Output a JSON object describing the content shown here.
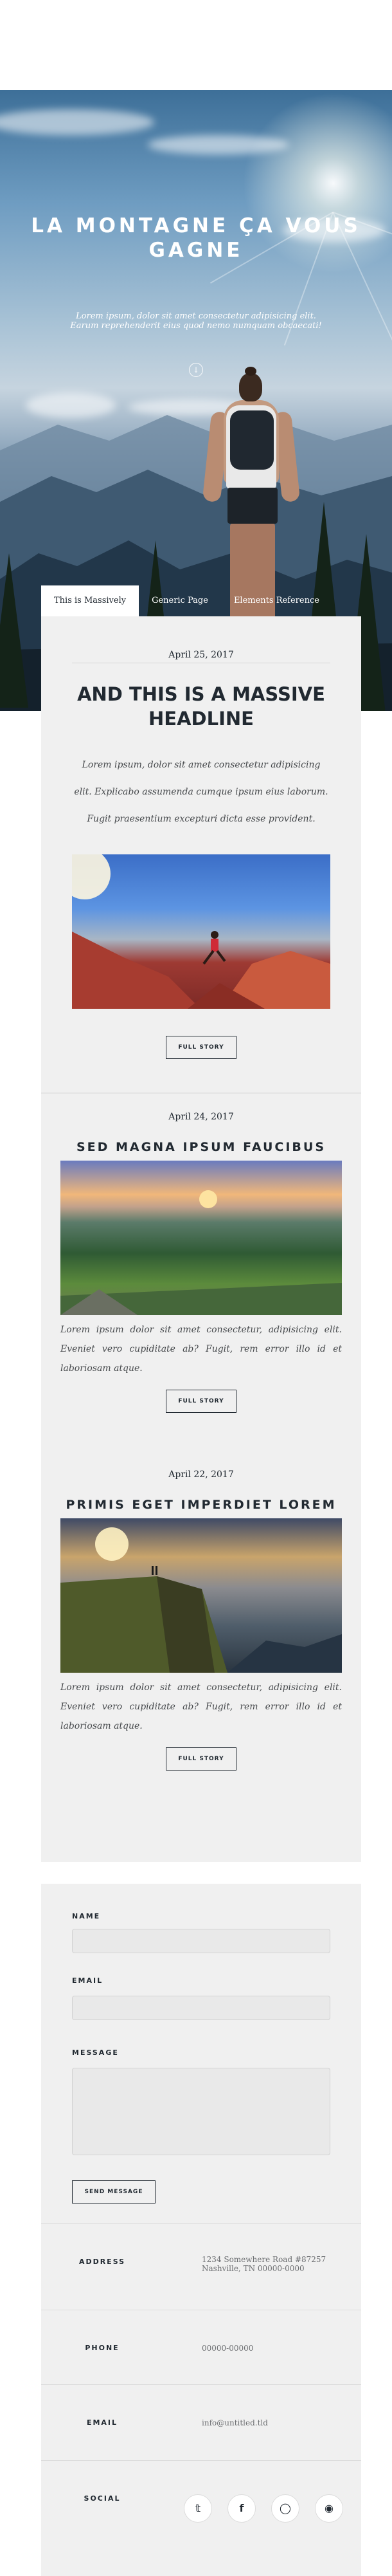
{
  "hero": {
    "title": "LA MONTAGNE ÇA VOUS GAGNE",
    "subtitle": "Lorem ipsum, dolor sit amet consectetur adipisicing elit. Earum reprehenderit eius quod nemo numquam obcaecati!",
    "scroll_icon": "arrow-down-icon"
  },
  "tabs": [
    {
      "label": "This is Massively",
      "active": true
    },
    {
      "label": "Generic Page",
      "active": false
    },
    {
      "label": "Elements Reference",
      "active": false
    }
  ],
  "featured": {
    "date": "April 25, 2017",
    "title": "AND THIS IS A MASSIVE HEADLINE",
    "text": "Lorem ipsum, dolor sit amet consectetur adipisicing elit. Explicabo assumenda cumque ipsum eius laborum. Fugit praesentium excepturi dicta esse provident.",
    "button": "FULL STORY"
  },
  "posts": [
    {
      "date": "April 24, 2017",
      "title": "SED MAGNA IPSUM FAUCIBUS",
      "text": "Lorem ipsum dolor sit amet consectetur, adipisicing elit. Eveniet vero cupiditate ab? Fugit, rem error illo id et laboriosam atque.",
      "button": "FULL STORY"
    },
    {
      "date": "April 22, 2017",
      "title": "PRIMIS EGET IMPERDIET LOREM",
      "text": "Lorem ipsum dolor sit amet consectetur, adipisicing elit. Eveniet vero cupiditate ab? Fugit, rem error illo id et laboriosam atque.",
      "button": "FULL STORY"
    }
  ],
  "contact": {
    "name_label": "NAME",
    "name_value": "",
    "email_label": "EMAIL",
    "email_value": "",
    "message_label": "MESSAGE",
    "message_value": "",
    "send_button": "SEND MESSAGE",
    "address_label": "ADDRESS",
    "address_line1": "1234 Somewhere Road #87257",
    "address_line2": "Nashville, TN 00000-0000",
    "phone_label": "PHONE",
    "phone_value": "00000-00000",
    "email_info_label": "EMAIL",
    "email_info_value": "info@untitled.tld",
    "social_label": "SOCIAL",
    "social_icons": [
      "twitter-icon",
      "facebook-icon",
      "instagram-icon",
      "github-icon"
    ]
  }
}
